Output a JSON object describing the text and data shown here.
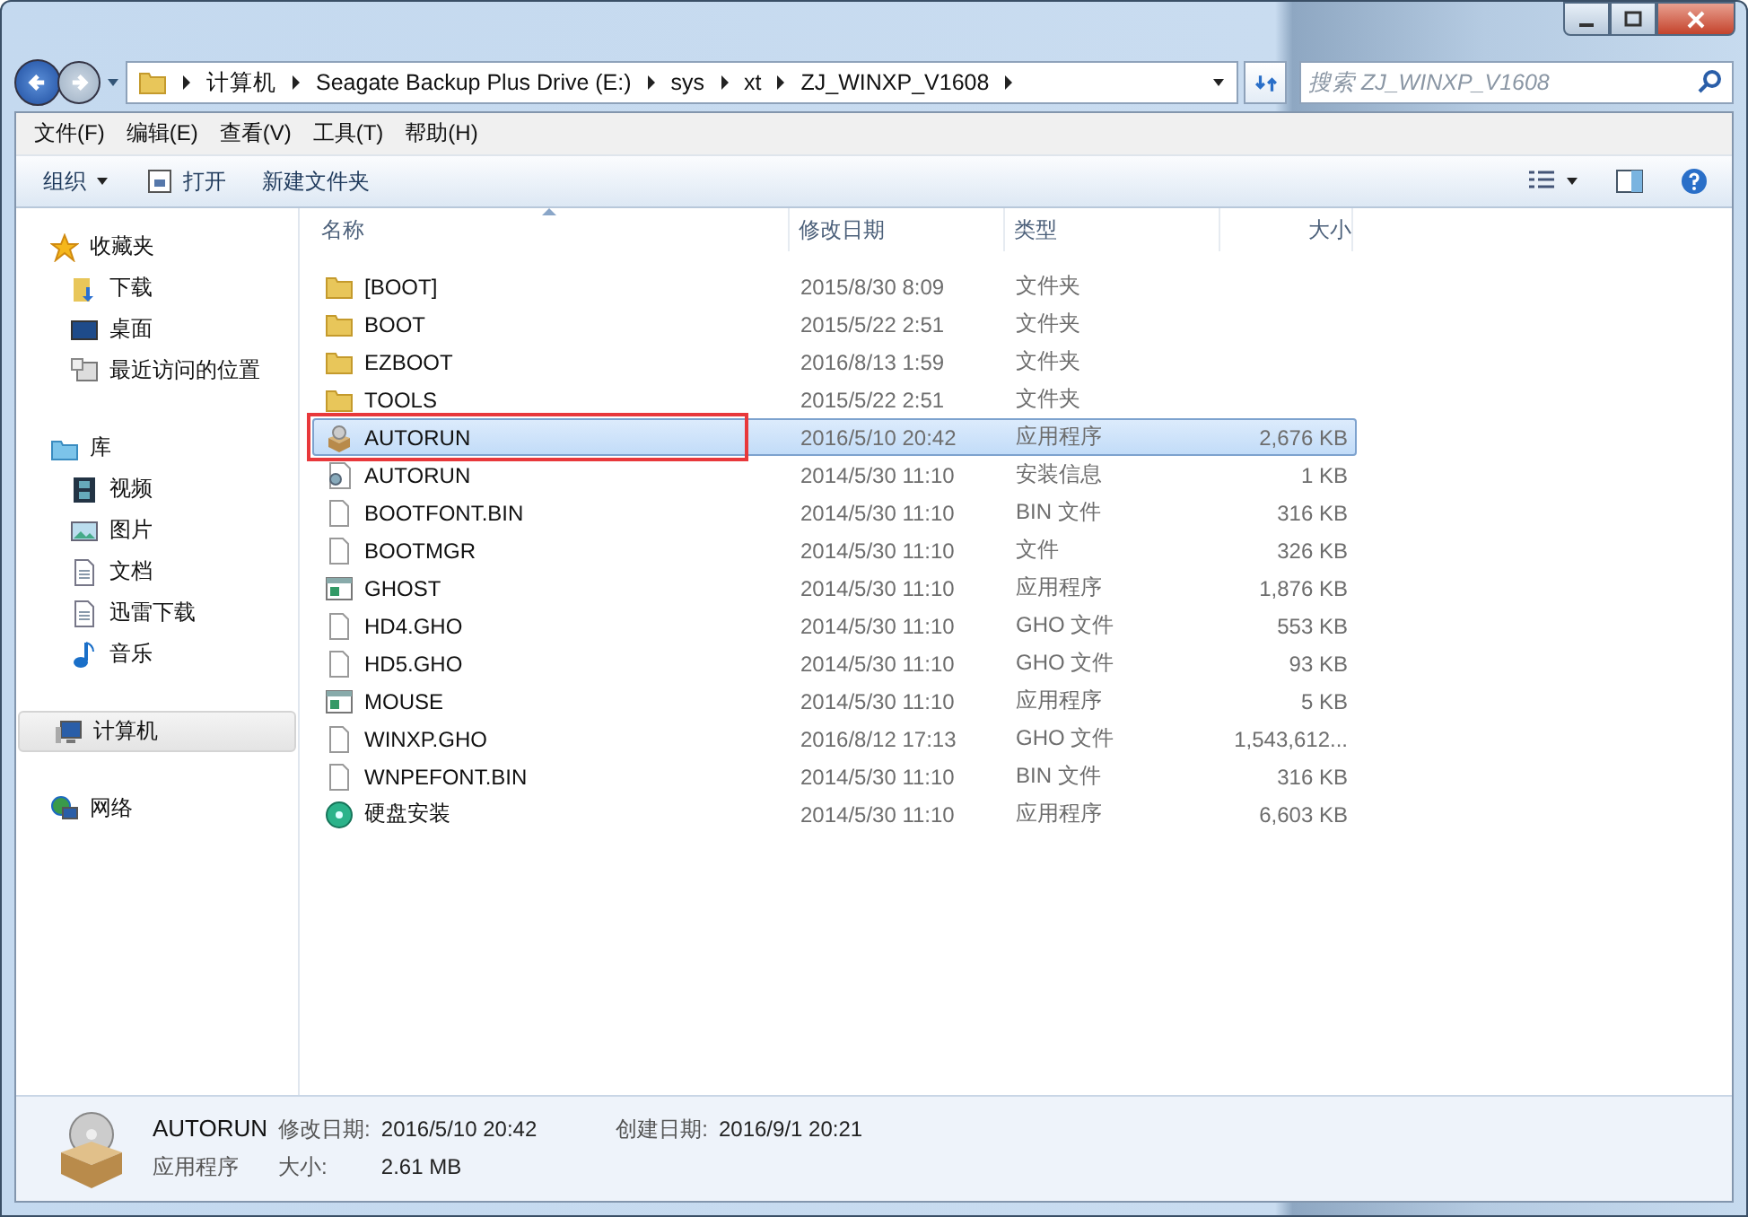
{
  "address": {
    "crumbs": [
      "计算机",
      "Seagate Backup Plus Drive (E:)",
      "sys",
      "xt",
      "ZJ_WINXP_V1608"
    ]
  },
  "search": {
    "placeholder": "搜索 ZJ_WINXP_V1608"
  },
  "menu": [
    "文件(F)",
    "编辑(E)",
    "查看(V)",
    "工具(T)",
    "帮助(H)"
  ],
  "toolbar": [
    {
      "label": "组织",
      "kind": "dropdown"
    },
    {
      "label": "打开",
      "kind": "open"
    },
    {
      "label": "新建文件夹",
      "kind": "plain"
    }
  ],
  "sidebar": [
    {
      "label": "收藏夹",
      "kind": "star",
      "selected": false,
      "children": [
        {
          "label": "下载",
          "kind": "download",
          "selected": false
        },
        {
          "label": "桌面",
          "kind": "desktop",
          "selected": false
        },
        {
          "label": "最近访问的位置",
          "kind": "recent",
          "selected": false
        }
      ]
    },
    {
      "label": "库",
      "kind": "library",
      "selected": false,
      "children": [
        {
          "label": "视频",
          "kind": "video",
          "selected": false
        },
        {
          "label": "图片",
          "kind": "picture",
          "selected": false
        },
        {
          "label": "文档",
          "kind": "doc",
          "selected": false
        },
        {
          "label": "迅雷下载",
          "kind": "doc",
          "selected": false
        },
        {
          "label": "音乐",
          "kind": "music",
          "selected": false
        }
      ]
    },
    {
      "label": "计算机",
      "kind": "computer",
      "selected": true
    },
    {
      "label": "网络",
      "kind": "network",
      "selected": false
    }
  ],
  "table": {
    "columns": [
      "名称",
      "修改日期",
      "类型",
      "大小"
    ],
    "rows": [
      {
        "kind": "folder",
        "name": "[BOOT]",
        "date": "2015/8/30 8:09",
        "type": "文件夹",
        "selected": false,
        "marked": false
      },
      {
        "kind": "folder",
        "name": "BOOT",
        "date": "2015/5/22 2:51",
        "type": "文件夹",
        "selected": false,
        "marked": false
      },
      {
        "kind": "folder",
        "name": "EZBOOT",
        "date": "2016/8/13 1:59",
        "type": "文件夹",
        "selected": false,
        "marked": false
      },
      {
        "kind": "folder",
        "name": "TOOLS",
        "date": "2015/5/22 2:51",
        "type": "文件夹",
        "selected": false,
        "marked": false
      },
      {
        "kind": "setup",
        "name": "AUTORUN",
        "date": "2016/5/10 20:42",
        "type": "应用程序",
        "size": "2,676 KB",
        "selected": true,
        "marked": true
      },
      {
        "kind": "config",
        "name": "AUTORUN",
        "date": "2014/5/30 11:10",
        "type": "安装信息",
        "size": "1 KB",
        "selected": false,
        "marked": false
      },
      {
        "kind": "file",
        "name": "BOOTFONT.BIN",
        "date": "2014/5/30 11:10",
        "type": "BIN 文件",
        "size": "316 KB",
        "selected": false,
        "marked": false
      },
      {
        "kind": "file",
        "name": "BOOTMGR",
        "date": "2014/5/30 11:10",
        "type": "文件",
        "size": "326 KB",
        "selected": false,
        "marked": false
      },
      {
        "kind": "app",
        "name": "GHOST",
        "date": "2014/5/30 11:10",
        "type": "应用程序",
        "size": "1,876 KB",
        "selected": false,
        "marked": false
      },
      {
        "kind": "file",
        "name": "HD4.GHO",
        "date": "2014/5/30 11:10",
        "type": "GHO 文件",
        "size": "553 KB",
        "selected": false,
        "marked": false
      },
      {
        "kind": "file",
        "name": "HD5.GHO",
        "date": "2014/5/30 11:10",
        "type": "GHO 文件",
        "size": "93 KB",
        "selected": false,
        "marked": false
      },
      {
        "kind": "app",
        "name": "MOUSE",
        "date": "2014/5/30 11:10",
        "type": "应用程序",
        "size": "5 KB",
        "selected": false,
        "marked": false
      },
      {
        "kind": "file",
        "name": "WINXP.GHO",
        "date": "2016/8/12 17:13",
        "type": "GHO 文件",
        "size": "1,543,612...",
        "selected": false,
        "marked": false
      },
      {
        "kind": "file",
        "name": "WNPEFONT.BIN",
        "date": "2014/5/30 11:10",
        "type": "BIN 文件",
        "size": "316 KB",
        "selected": false,
        "marked": false
      },
      {
        "kind": "disc",
        "name": "硬盘安装",
        "date": "2014/5/30 11:10",
        "type": "应用程序",
        "size": "6,603 KB",
        "selected": false,
        "marked": false
      }
    ]
  },
  "details": {
    "name": "AUTORUN",
    "type": "应用程序",
    "fields": [
      {
        "label": "修改日期:",
        "value": "2016/5/10 20:42"
      },
      {
        "label": "大小:",
        "value": "2.61 MB"
      },
      {
        "label": "创建日期:",
        "value": "2016/9/1 20:21"
      }
    ]
  }
}
